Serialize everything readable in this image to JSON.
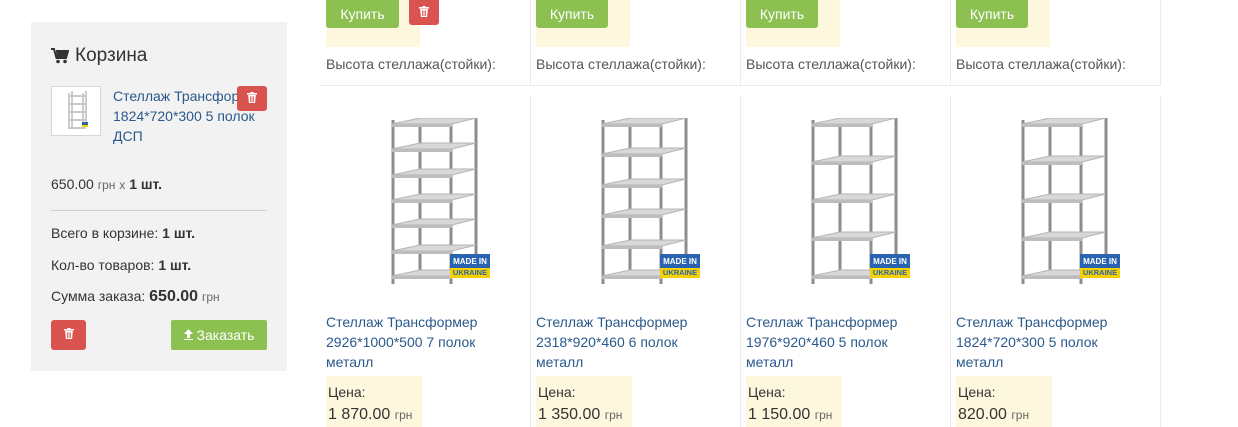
{
  "cart": {
    "title": "Корзина",
    "item": {
      "name": "Стеллаж Трансформер 1824*720*300 5 полок ДСП",
      "price": "650.00",
      "currency": "грн",
      "times": "x",
      "qty": "1 шт."
    },
    "total_label": "Всего в корзине:",
    "total_value": "1 шт.",
    "count_label": "Кол-во товаров:",
    "count_value": "1 шт.",
    "sum_label": "Сумма заказа:",
    "sum_value": "650.00",
    "sum_currency": "грн",
    "order_button": "Заказать"
  },
  "top_row": {
    "buy_label": "Купить",
    "height_label": "Высота стеллажа(стойки):"
  },
  "products": [
    {
      "name": "Стеллаж Трансформер 2926*1000*500 7 полок металл",
      "price_label": "Цена:",
      "price": "1 870.00",
      "currency": "грн",
      "shelves": 7
    },
    {
      "name": "Стеллаж Трансформер 2318*920*460 6 полок металл",
      "price_label": "Цена:",
      "price": "1 350.00",
      "currency": "грн",
      "shelves": 6
    },
    {
      "name": "Стеллаж Трансформер 1976*920*460 5 полок металл",
      "price_label": "Цена:",
      "price": "1 150.00",
      "currency": "грн",
      "shelves": 5
    },
    {
      "name": "Стеллаж Трансформер 1824*720*300 5 полок металл",
      "price_label": "Цена:",
      "price": "820.00",
      "currency": "грн",
      "shelves": 5
    }
  ],
  "badge": {
    "line1": "MADE IN",
    "line2": "UKRAINE"
  },
  "colors": {
    "buy": "#8cc152",
    "delete": "#d9534f",
    "link": "#2a5a8c",
    "price_bg": "#fdf8dd",
    "cart_bg": "#f2f2f2"
  }
}
